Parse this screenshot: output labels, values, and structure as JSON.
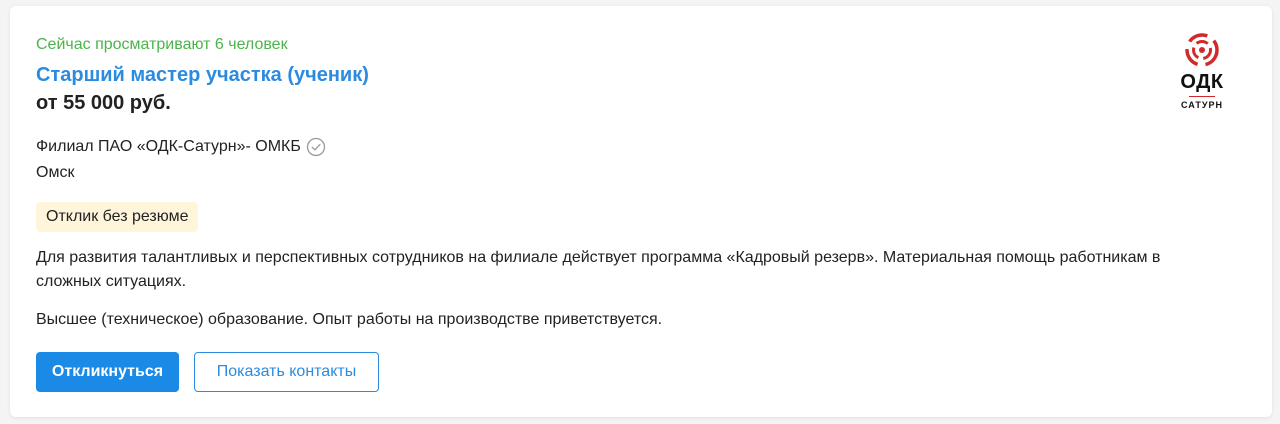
{
  "vacancy": {
    "viewers_text": "Сейчас просматривают 6 человек",
    "title": "Старший мастер участка (ученик)",
    "salary": "от 55 000 руб.",
    "employer": "Филиал ПАО «ОДК-Сатурн»- ОМКБ",
    "verified_icon": "check-circle-icon",
    "city": "Омск",
    "badge": "Отклик без резюме",
    "description": "Для развития талантливых и перспективных сотрудников на филиале действует программа «Кадровый резерв». Материальная помощь работникам в сложных ситуациях.",
    "requirements": "Высшее (техническое) образование. Опыт работы на производстве приветствуется."
  },
  "actions": {
    "respond_label": "Откликнуться",
    "contacts_label": "Показать контакты"
  },
  "logo": {
    "main_text": "ОДК",
    "sub_text": "САТУРН"
  },
  "colors": {
    "viewers": "#4bb34b",
    "link": "#2b8be0",
    "primary_button": "#1a8ae6",
    "badge_bg": "#fff5db",
    "logo_accent": "#d12a2a"
  }
}
